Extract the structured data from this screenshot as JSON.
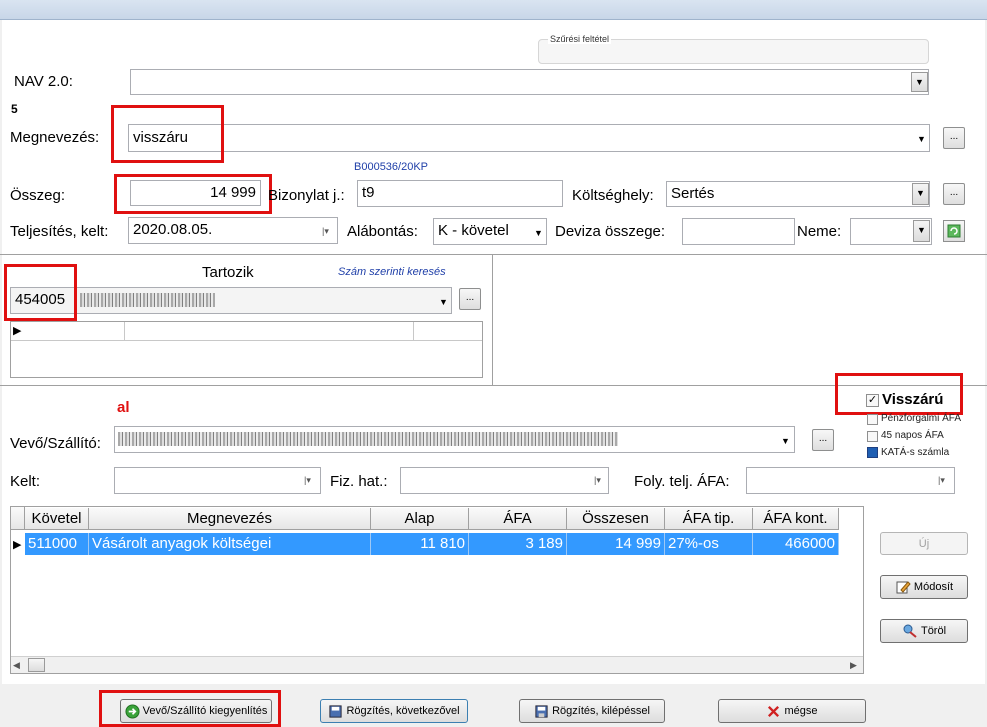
{
  "filter": {
    "title": "Szűrési feltétel"
  },
  "nav": {
    "label": "NAV 2.0:",
    "value": "",
    "note": "5"
  },
  "megnevezes": {
    "label": "Megnevezés:",
    "value": "visszáru",
    "button": "..."
  },
  "bizonylat": {
    "code": "B000536/20KP",
    "label": "Bizonylat j.:",
    "value": "t9"
  },
  "osszeg": {
    "label": "Összeg:",
    "value": "14 999"
  },
  "koltseghely": {
    "label": "Költséghely:",
    "value": "Sertés",
    "button": "..."
  },
  "teljesites": {
    "label": "Teljesítés, kelt:",
    "value": "2020.08.05."
  },
  "alabontas": {
    "label": "Alábontás:",
    "value": "K - követel"
  },
  "deviza": {
    "label": "Deviza összege:",
    "value": ""
  },
  "neme": {
    "label": "Neme:",
    "value": ""
  },
  "tartozik": {
    "title": "Tartozik",
    "search_link": "Szám szerinti keresés",
    "account": "454005",
    "button": "..."
  },
  "al_note": "al",
  "vevo": {
    "label": "Vevő/Szállító:",
    "button": "..."
  },
  "visszaru": {
    "label": "Visszárú",
    "checked": true
  },
  "options": [
    {
      "label": "Pénzforgalmi ÁFA",
      "checked": false
    },
    {
      "label": "45 napos ÁFA",
      "checked": false
    },
    {
      "label": "KATÁ-s számla",
      "checked": true
    }
  ],
  "kelt": {
    "label": "Kelt:",
    "value": ""
  },
  "fizhat": {
    "label": "Fiz. hat.:",
    "value": ""
  },
  "folyteljafa": {
    "label": "Foly. telj. ÁFA:",
    "value": ""
  },
  "table": {
    "columns": [
      "Követel",
      "Megnevezés",
      "Alap",
      "ÁFA",
      "Összesen",
      "ÁFA tip.",
      "ÁFA kont."
    ],
    "rows": [
      [
        "511000",
        "Vásárolt anyagok költségei",
        "11 810",
        "3 189",
        "14 999",
        "27%-os",
        "466000"
      ]
    ]
  },
  "side_buttons": {
    "uj": "Új",
    "modosit": "Módosít",
    "torol": "Töröl"
  },
  "bottom_buttons": {
    "kiegyenlites": "Vevő/Szállító kiegyenlítés",
    "kovetkezovel": "Rögzítés, következővel",
    "kilepessel": "Rögzítés, kilépéssel",
    "megse": "mégse"
  },
  "colors": {
    "highlight": "#e01010",
    "selection": "#3399ff",
    "link": "#1f3fa8"
  }
}
